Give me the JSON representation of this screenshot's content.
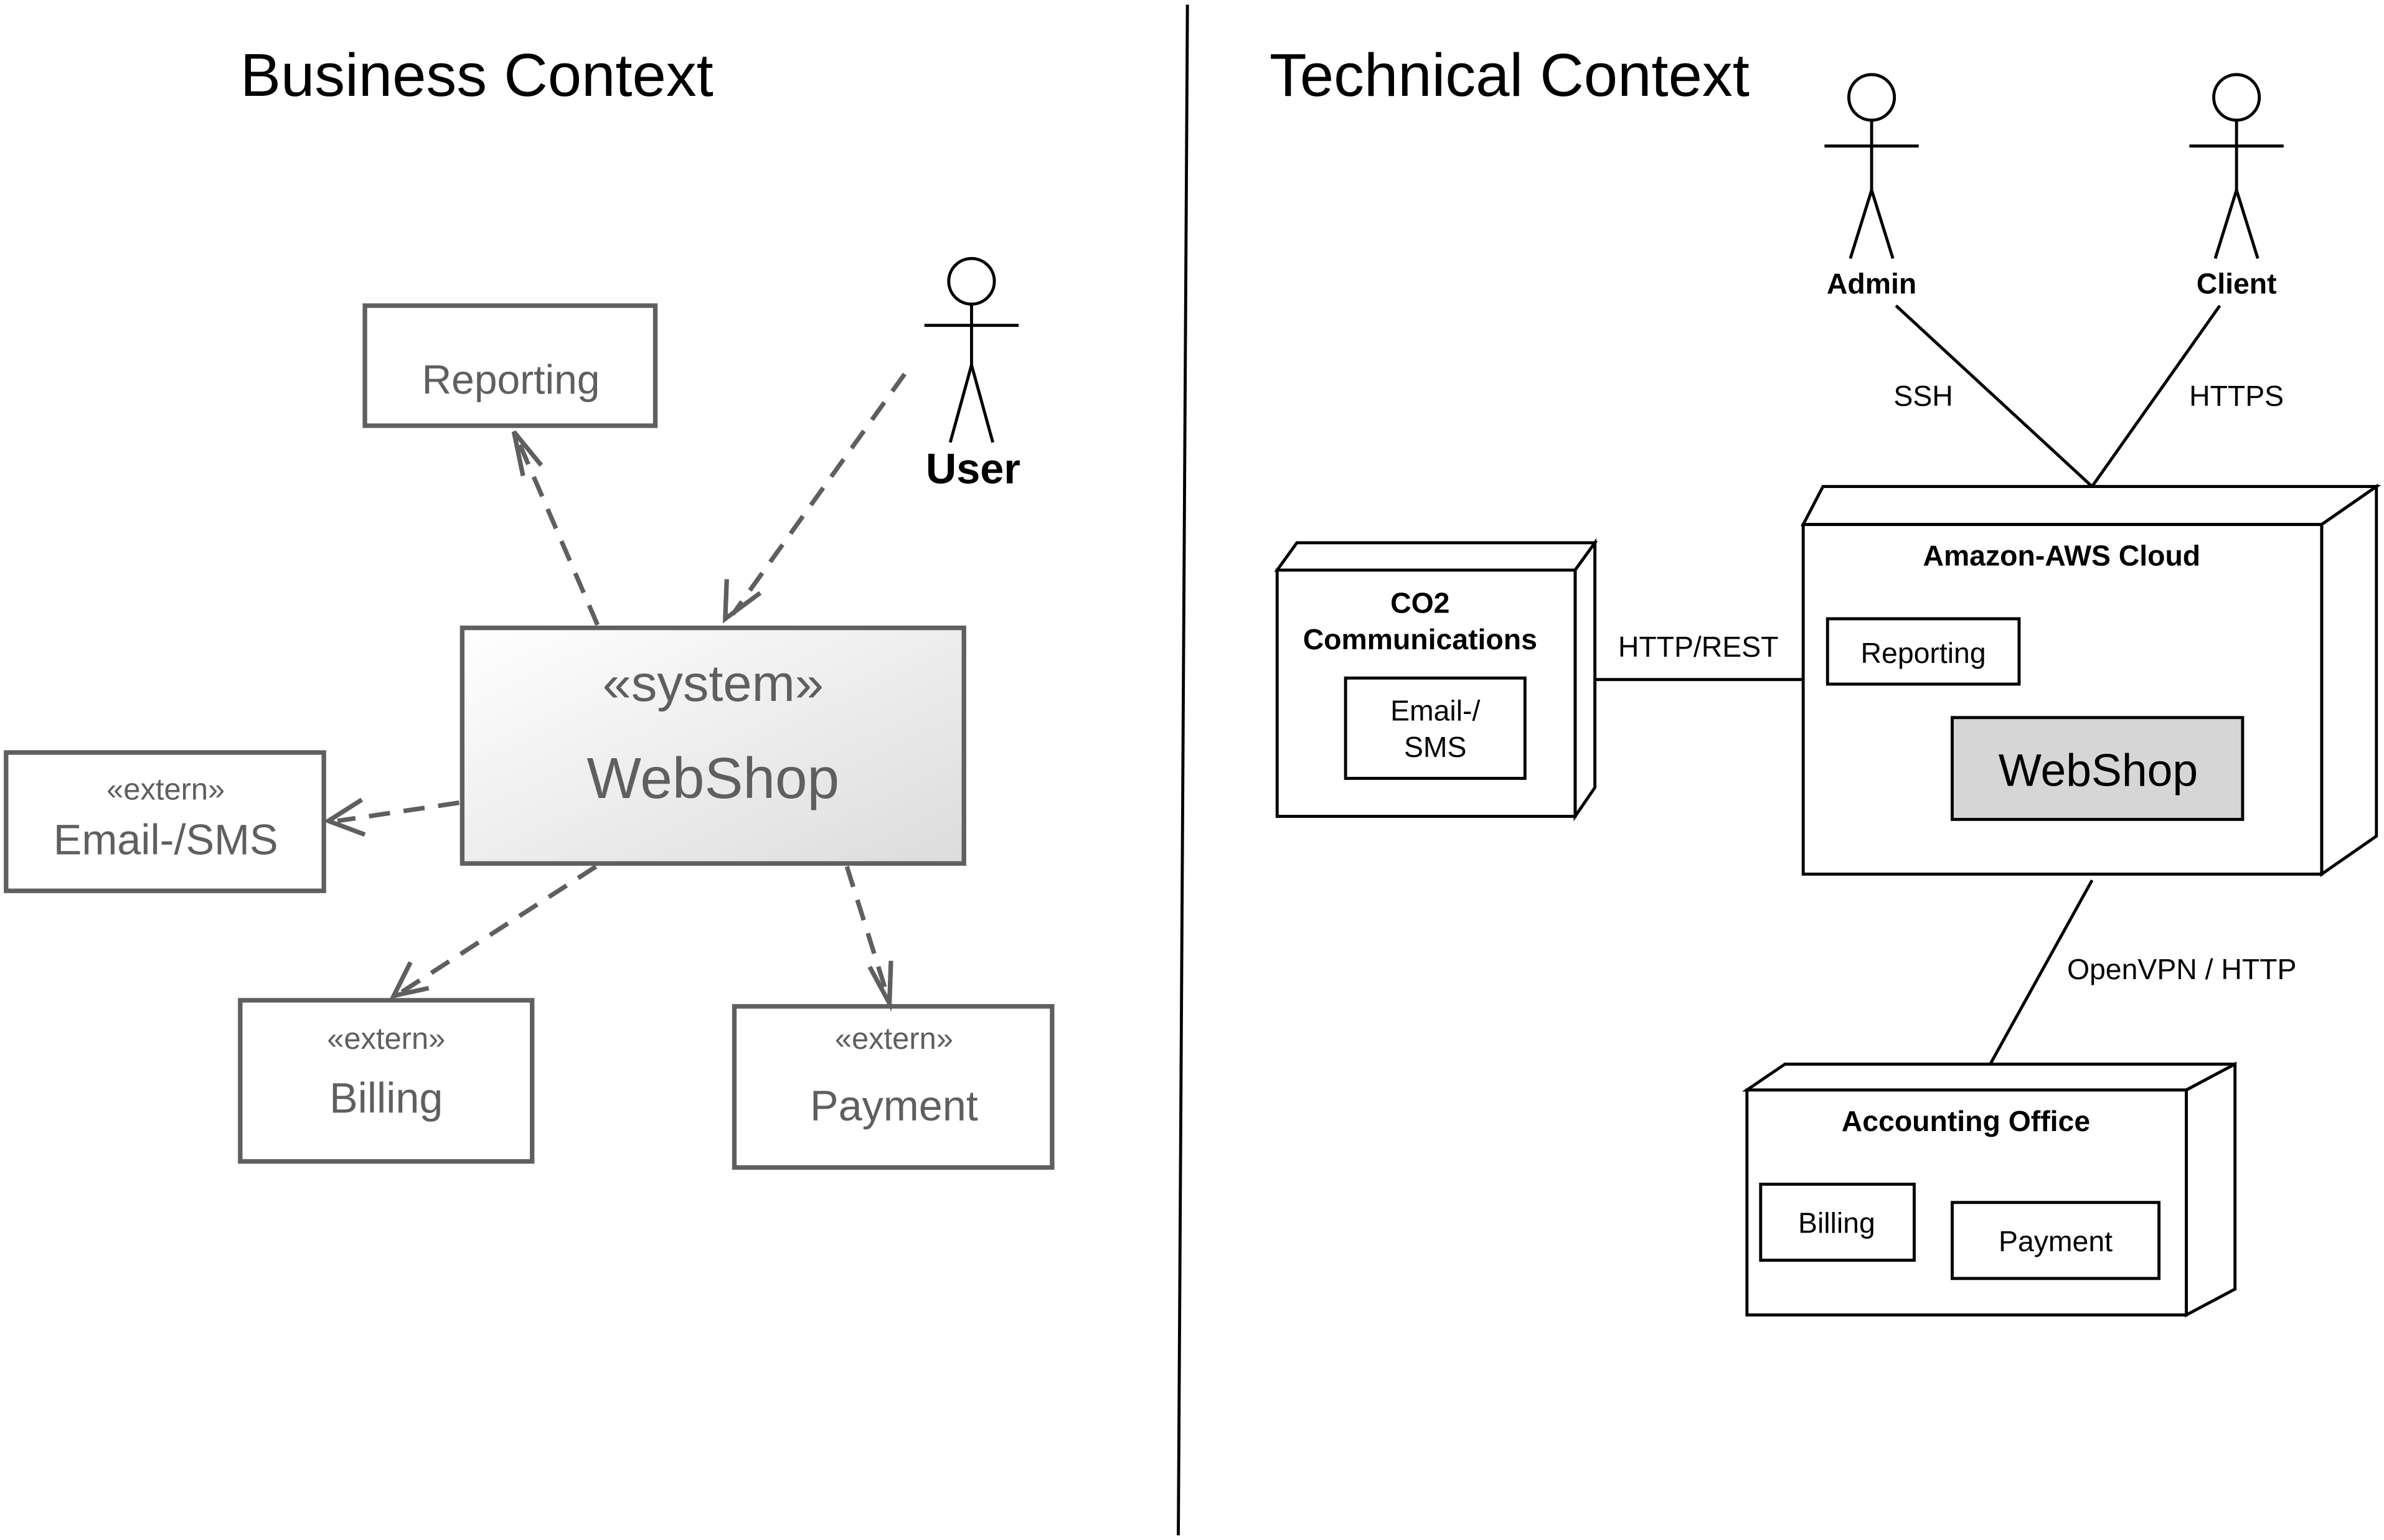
{
  "business_context": {
    "title": "Business Context",
    "actor": {
      "label": "User"
    },
    "system": {
      "stereotype": "«system»",
      "name": "WebShop"
    },
    "components": {
      "reporting": {
        "name": "Reporting"
      },
      "email_sms": {
        "stereotype": "«extern»",
        "name": "Email-/SMS"
      },
      "billing": {
        "stereotype": "«extern»",
        "name": "Billing"
      },
      "payment": {
        "stereotype": "«extern»",
        "name": "Payment"
      }
    }
  },
  "technical_context": {
    "title": "Technical Context",
    "actors": {
      "admin": {
        "label": "Admin"
      },
      "client": {
        "label": "Client"
      }
    },
    "connections": {
      "ssh": "SSH",
      "https": "HTTPS",
      "http_rest": "HTTP/REST",
      "openvpn": "OpenVPN / HTTP"
    },
    "nodes": {
      "co2": {
        "line1": "CO2",
        "line2": "Communications",
        "component_line1": "Email-/",
        "component_line2": "SMS"
      },
      "aws": {
        "name": "Amazon-AWS Cloud",
        "reporting": "Reporting",
        "webshop": "WebShop"
      },
      "accounting": {
        "name": "Accounting Office",
        "billing": "Billing",
        "payment": "Payment"
      }
    }
  },
  "colors": {
    "webshop_fill": "#d6d6d6",
    "business_stroke": "#5f5f5f"
  }
}
